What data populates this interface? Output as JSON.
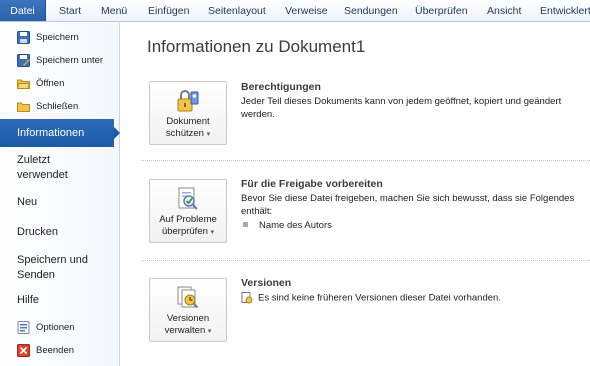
{
  "ribbon": {
    "file_tab": "Datei",
    "tabs": [
      "Start",
      "Menü",
      "Einfügen",
      "Seitenlayout",
      "Verweise",
      "Sendungen",
      "Überprüfen",
      "Ansicht",
      "Entwicklertools"
    ]
  },
  "nav": {
    "commands_top": [
      {
        "label": "Speichern",
        "icon": "save-icon"
      },
      {
        "label": "Speichern unter",
        "icon": "save-as-icon"
      },
      {
        "label": "Öffnen",
        "icon": "open-folder-icon"
      },
      {
        "label": "Schließen",
        "icon": "close-folder-icon"
      }
    ],
    "sections": [
      "Informationen",
      "Zuletzt verwendet",
      "Neu",
      "Drucken",
      "Speichern und Senden",
      "Hilfe"
    ],
    "active_section": "Informationen",
    "commands_bottom": [
      {
        "label": "Optionen",
        "icon": "options-icon"
      },
      {
        "label": "Beenden",
        "icon": "exit-icon"
      }
    ]
  },
  "main": {
    "title": "Informationen zu Dokument1",
    "permissions": {
      "button_line1": "Dokument",
      "button_line2": "schützen",
      "heading": "Berechtigungen",
      "description": "Jeder Teil dieses Dokuments kann von jedem geöffnet, kopiert und geändert werden."
    },
    "prepare": {
      "button_line1": "Auf Probleme",
      "button_line2": "überprüfen",
      "heading": "Für die Freigabe vorbereiten",
      "description": "Bevor Sie diese Datei freigeben, machen Sie sich bewusst, dass sie Folgendes enthält:",
      "items": [
        "Name des Autors"
      ]
    },
    "versions": {
      "button_line1": "Versionen",
      "button_line2": "verwalten",
      "heading": "Versionen",
      "status": "Es sind keine früheren Versionen dieser Datei vorhanden."
    }
  },
  "colors": {
    "file_tab": "#2a62a8",
    "active_nav": "#1b5aa5",
    "tab_text": "#1e395b"
  }
}
